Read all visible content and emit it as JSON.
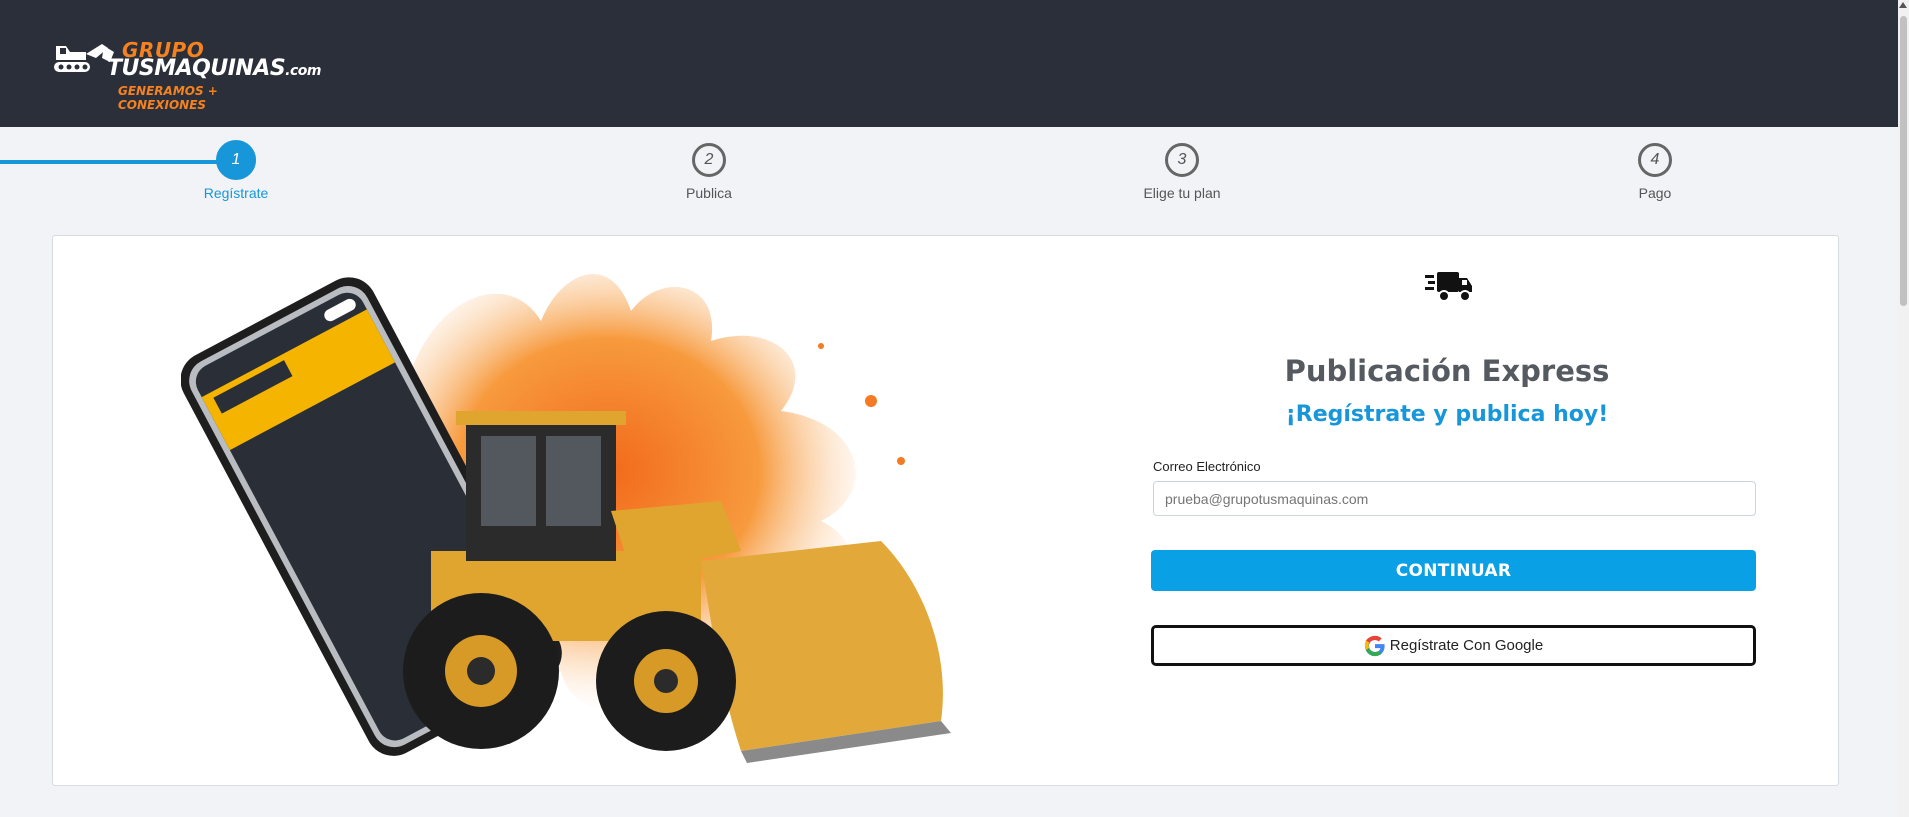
{
  "header": {
    "logo_line1": "GRUPO",
    "logo_line2": "TUSMAQUINAS",
    "logo_domain": ".com",
    "logo_tagline": "GENERAMOS + CONEXIONES"
  },
  "stepper": {
    "steps": [
      {
        "number": "1",
        "label": "Regístrate",
        "active": true
      },
      {
        "number": "2",
        "label": "Publica",
        "active": false
      },
      {
        "number": "3",
        "label": "Elige tu plan",
        "active": false
      },
      {
        "number": "4",
        "label": "Pago",
        "active": false
      }
    ]
  },
  "form": {
    "icon": "fast-truck-icon",
    "title": "Publicación Express",
    "subtitle": "¡Regístrate y publica hoy!",
    "email_label": "Correo Electrónico",
    "email_placeholder": "prueba@grupotusmaquinas.com",
    "continue_label": "CONTINUAR",
    "google_label": "Regístrate Con Google"
  },
  "colors": {
    "header_bg": "#2b2f3a",
    "accent_blue": "#1797d9",
    "button_blue": "#0aa0e5",
    "logo_orange": "#f5821f"
  }
}
